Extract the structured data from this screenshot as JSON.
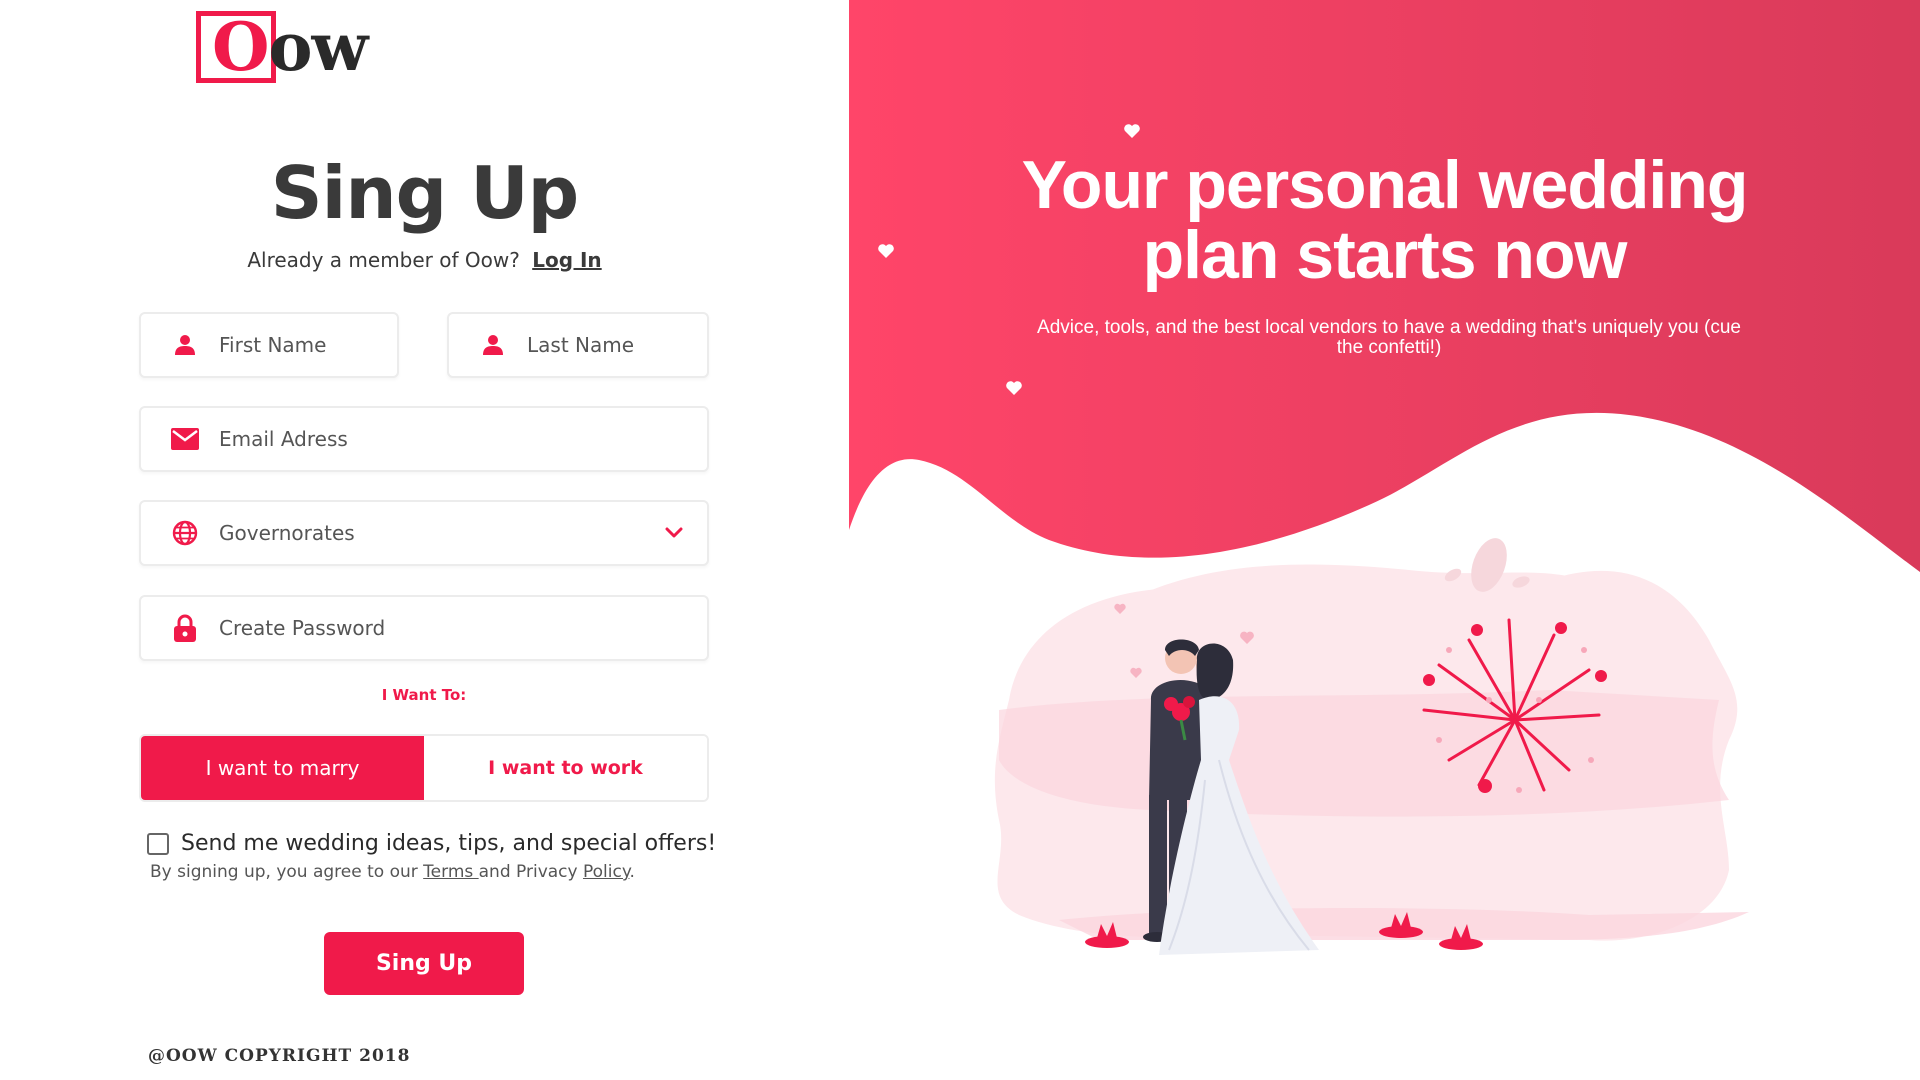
{
  "brand": {
    "logo_text_first": "O",
    "logo_text_rest": "ow",
    "accent_color": "#f01a4a"
  },
  "form": {
    "title": "Sing Up",
    "member_prompt": "Already a member of Oow?",
    "login_link": "Log In",
    "first_name_placeholder": "First Name",
    "last_name_placeholder": "Last Name",
    "email_placeholder": "Email Adress",
    "governorates_label": "Governorates",
    "password_placeholder": "Create Password",
    "want_label": "I Want To:",
    "option_marry": "I want to marry",
    "option_work": "I want to work",
    "selected_option": "I want to marry",
    "newsletter_label": "Send me wedding ideas, tips, and special offers!",
    "newsletter_checked": false,
    "terms_prefix": "By signing up, you agree to our",
    "terms_link": "Terms ",
    "terms_middle": "and Privacy",
    "policy_link": "Policy",
    "terms_suffix": ".",
    "submit_label": "Sing Up"
  },
  "icons": {
    "first_name": "user-icon",
    "last_name": "user-icon",
    "email": "envelope-icon",
    "governorates": "globe-icon",
    "dropdown": "chevron-down-icon",
    "password": "lock-icon"
  },
  "hero": {
    "headline_line1": "Your personal wedding",
    "headline_line2": "plan starts now",
    "subtitle": "Advice, tools, and the best local vendors to have a wedding that's uniquely you (cue the confetti!)",
    "gradient_start": "#ff4569",
    "gradient_end": "#d93a5a"
  },
  "footer": {
    "copyright": "@OOW COPYRIGHT  2018"
  }
}
